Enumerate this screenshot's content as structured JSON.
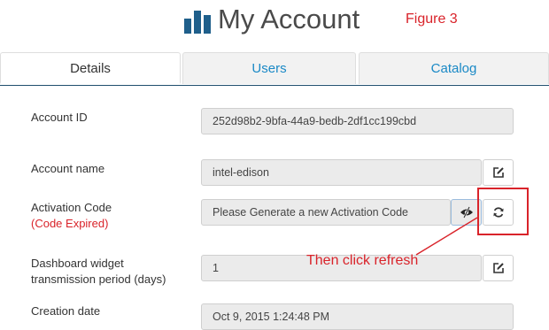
{
  "header": {
    "title": "My Account",
    "figure_label": "Figure 3",
    "logo_icon": "bar-chart-icon"
  },
  "tabs": [
    {
      "label": "Details",
      "active": true
    },
    {
      "label": "Users",
      "active": false
    },
    {
      "label": "Catalog",
      "active": false
    }
  ],
  "fields": {
    "account_id": {
      "label": "Account ID",
      "value": "252d98b2-9bfa-44a9-bedb-2df1cc199cbd"
    },
    "account_name": {
      "label": "Account name",
      "value": "intel-edison",
      "button_icon": "edit-icon"
    },
    "activation_code": {
      "label": "Activation Code",
      "sublabel": "(Code Expired)",
      "value": "Please Generate a new Activation Code",
      "toggle_icon": "eye-slash-icon",
      "button_icon": "refresh-icon"
    },
    "dashboard_widget": {
      "label_line1": "Dashboard widget",
      "label_line2": "transmission period (days)",
      "value": "1",
      "button_icon": "edit-icon"
    },
    "creation_date": {
      "label": "Creation date",
      "value": "Oct 9, 2015 1:24:48 PM"
    }
  },
  "annotation": {
    "text": "Then click refresh"
  },
  "colors": {
    "accent_red": "#d9232a",
    "tab_blue": "#1a89c6",
    "logo_blue": "#1f5f8b"
  }
}
